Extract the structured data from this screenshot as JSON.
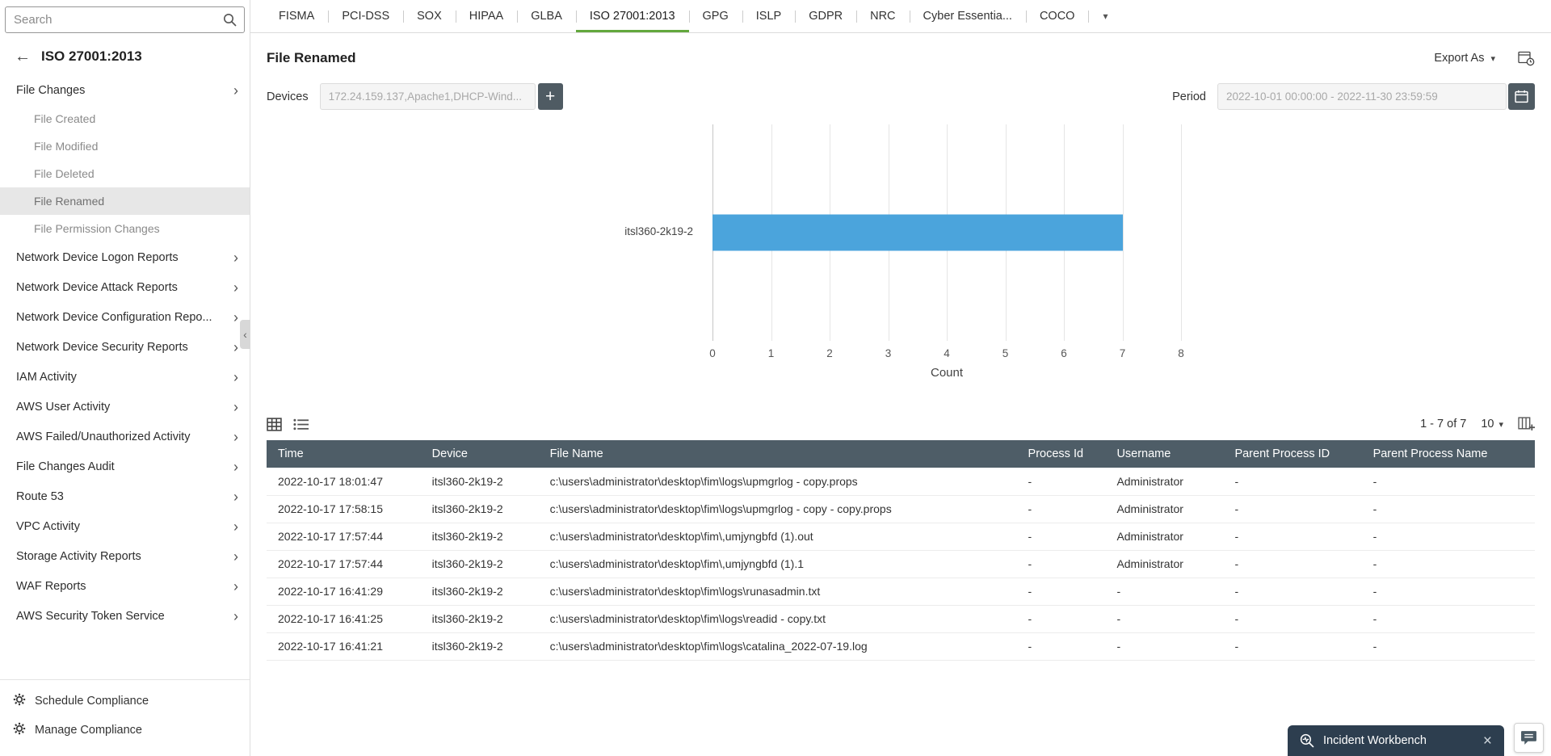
{
  "sidebar": {
    "search_placeholder": "Search",
    "title": "ISO 27001:2013",
    "items": [
      {
        "label": "File Changes",
        "children": [
          "File Created",
          "File Modified",
          "File Deleted",
          "File Renamed",
          "File Permission Changes"
        ],
        "selected_child": "File Renamed"
      },
      {
        "label": "Network Device Logon Reports"
      },
      {
        "label": "Network Device Attack Reports"
      },
      {
        "label": "Network Device Configuration Repo..."
      },
      {
        "label": "Network Device Security Reports"
      },
      {
        "label": "IAM Activity"
      },
      {
        "label": "AWS User Activity"
      },
      {
        "label": "AWS Failed/Unauthorized Activity"
      },
      {
        "label": "File Changes Audit"
      },
      {
        "label": "Route 53"
      },
      {
        "label": "VPC Activity"
      },
      {
        "label": "Storage Activity Reports"
      },
      {
        "label": "WAF Reports"
      },
      {
        "label": "AWS Security Token Service"
      }
    ],
    "footer": [
      "Schedule Compliance",
      "Manage Compliance"
    ]
  },
  "tabs": {
    "items": [
      "FISMA",
      "PCI-DSS",
      "SOX",
      "HIPAA",
      "GLBA",
      "ISO 27001:2013",
      "GPG",
      "ISLP",
      "GDPR",
      "NRC",
      "Cyber Essentia...",
      "COCO"
    ],
    "active": "ISO 27001:2013"
  },
  "header": {
    "title": "File Renamed",
    "export_label": "Export As"
  },
  "filters": {
    "devices_label": "Devices",
    "devices_value": "172.24.159.137,Apache1,DHCP-Wind...",
    "period_label": "Period",
    "period_value": "2022-10-01 00:00:00 - 2022-11-30 23:59:59"
  },
  "chart_data": {
    "type": "bar",
    "orientation": "horizontal",
    "categories": [
      "itsl360-2k19-2"
    ],
    "values": [
      7
    ],
    "title": "",
    "xlabel": "Count",
    "ylabel": "",
    "xlim": [
      0,
      8
    ],
    "xticks": [
      0,
      1,
      2,
      3,
      4,
      5,
      6,
      7,
      8
    ],
    "grid": true,
    "bar_color": "#4BA4DC"
  },
  "table": {
    "pagination": "1 - 7 of 7",
    "page_size": "10",
    "columns": [
      "Time",
      "Device",
      "File Name",
      "Process Id",
      "Username",
      "Parent Process ID",
      "Parent Process Name"
    ],
    "rows": [
      [
        "2022-10-17 18:01:47",
        "itsl360-2k19-2",
        "c:\\users\\administrator\\desktop\\fim\\logs\\upmgrlog - copy.props",
        "-",
        "Administrator",
        "-",
        "-"
      ],
      [
        "2022-10-17 17:58:15",
        "itsl360-2k19-2",
        "c:\\users\\administrator\\desktop\\fim\\logs\\upmgrlog - copy - copy.props",
        "-",
        "Administrator",
        "-",
        "-"
      ],
      [
        "2022-10-17 17:57:44",
        "itsl360-2k19-2",
        "c:\\users\\administrator\\desktop\\fim\\,umjyngbfd (1).out",
        "-",
        "Administrator",
        "-",
        "-"
      ],
      [
        "2022-10-17 17:57:44",
        "itsl360-2k19-2",
        "c:\\users\\administrator\\desktop\\fim\\,umjyngbfd (1).1",
        "-",
        "Administrator",
        "-",
        "-"
      ],
      [
        "2022-10-17 16:41:29",
        "itsl360-2k19-2",
        "c:\\users\\administrator\\desktop\\fim\\logs\\runasadmin.txt",
        "-",
        "-",
        "-",
        "-"
      ],
      [
        "2022-10-17 16:41:25",
        "itsl360-2k19-2",
        "c:\\users\\administrator\\desktop\\fim\\logs\\readid - copy.txt",
        "-",
        "-",
        "-",
        "-"
      ],
      [
        "2022-10-17 16:41:21",
        "itsl360-2k19-2",
        "c:\\users\\administrator\\desktop\\fim\\logs\\catalina_2022-07-19.log",
        "-",
        "-",
        "-",
        "-"
      ]
    ]
  },
  "incident_workbench": {
    "label": "Incident Workbench"
  }
}
